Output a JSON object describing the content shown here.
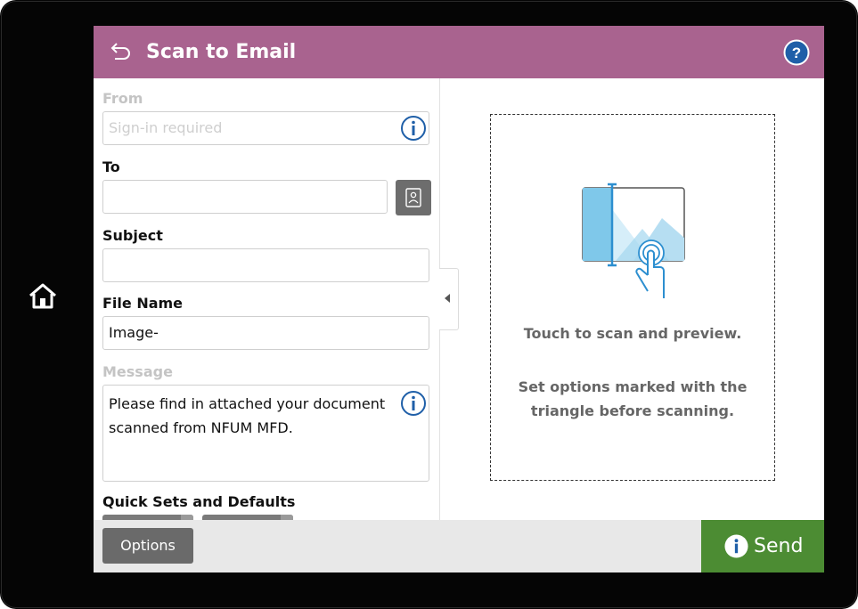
{
  "header": {
    "title": "Scan to Email",
    "back_icon": "back-arrow-icon",
    "help_icon": "help-icon"
  },
  "form": {
    "from_label": "From",
    "from_placeholder": "Sign-in required",
    "to_label": "To",
    "to_value": "",
    "subject_label": "Subject",
    "subject_value": "",
    "file_name_label": "File Name",
    "file_name_value": "Image-",
    "message_label": "Message",
    "message_value": "Please find in attached your document scanned from NFUM MFD.",
    "quick_sets_label": "Quick Sets and Defaults"
  },
  "preview": {
    "touch_text": "Touch to scan and preview.",
    "options_text": "Set options marked with the triangle before scanning."
  },
  "footer": {
    "options_label": "Options",
    "send_label": "Send"
  },
  "colors": {
    "header": "#a9638f",
    "send": "#4c8c33",
    "options_button": "#6a6a6a",
    "info_icon": "#1f5fa8",
    "illustration_blue": "#7fc8ea"
  }
}
